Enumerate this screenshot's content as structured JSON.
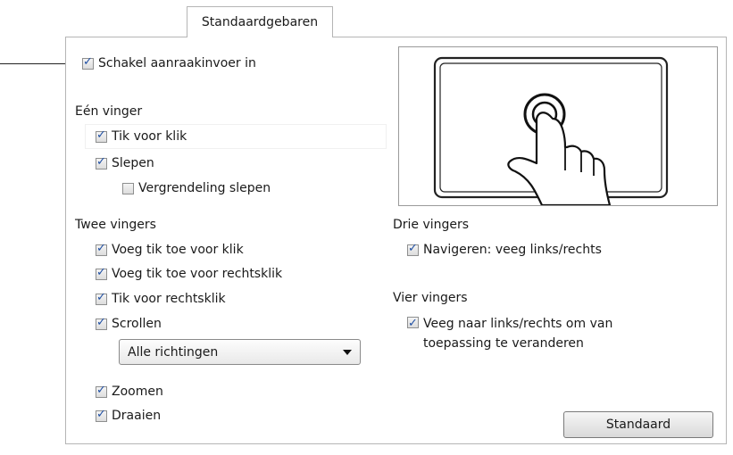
{
  "tab": {
    "label": "Standaardgebaren"
  },
  "main_toggle": {
    "label": "Schakel aanraakinvoer in",
    "checked": true
  },
  "one_finger": {
    "heading": "Eén vinger",
    "tap_click": {
      "label": "Tik voor klik",
      "checked": true
    },
    "drag": {
      "label": "Slepen",
      "checked": true
    },
    "drag_lock": {
      "label": "Vergrendeling slepen",
      "checked": false
    }
  },
  "two_fingers": {
    "heading": "Twee vingers",
    "add_tap_click": {
      "label": "Voeg tik toe voor klik",
      "checked": true
    },
    "add_tap_right": {
      "label": "Voeg tik toe voor rechtsklik",
      "checked": true
    },
    "tap_right": {
      "label": "Tik voor rechtsklik",
      "checked": true
    },
    "scroll": {
      "label": "Scrollen",
      "checked": true
    },
    "scroll_direction": {
      "selected": "Alle richtingen"
    },
    "zoom": {
      "label": "Zoomen",
      "checked": true
    },
    "rotate": {
      "label": "Draaien",
      "checked": true
    }
  },
  "three_fingers": {
    "heading": "Drie vingers",
    "navigate": {
      "label": "Navigeren: veeg links/rechts",
      "checked": true
    }
  },
  "four_fingers": {
    "heading": "Vier vingers",
    "switch_app": {
      "label": "Veeg naar links/rechts om van toepassing te veranderen",
      "checked": true
    }
  },
  "default_button": {
    "label": "Standaard"
  },
  "preview_icon": "touchpad-tap-gesture-illustration"
}
